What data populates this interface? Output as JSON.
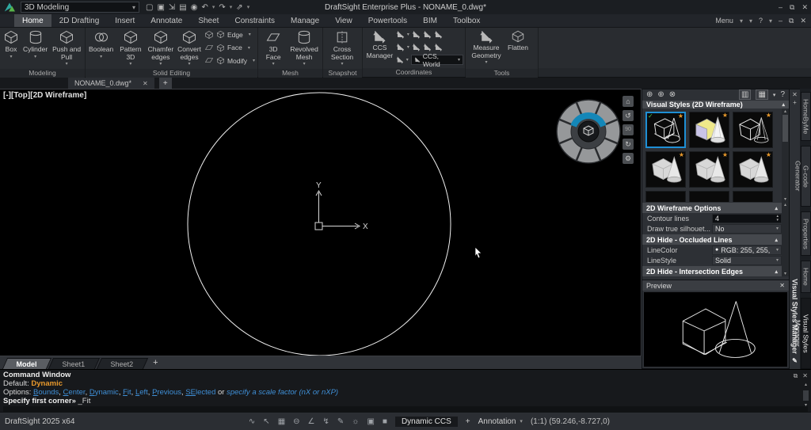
{
  "titlebar": {
    "workspace": "3D Modeling",
    "title": "DraftSight Enterprise Plus - NONAME_0.dwg*",
    "menu": "Menu",
    "help": "?"
  },
  "tabs": {
    "items": [
      "Home",
      "2D Drafting",
      "Insert",
      "Annotate",
      "Sheet",
      "Constraints",
      "Manage",
      "View",
      "Powertools",
      "BIM",
      "Toolbox"
    ],
    "active": "Home"
  },
  "ribbon": {
    "modeling": {
      "label": "Modeling",
      "box": "Box",
      "cylinder": "Cylinder",
      "push_pull": "Push and Pull"
    },
    "solid_editing": {
      "label": "Solid Editing",
      "boolean": "Boolean",
      "pattern": "Pattern 3D",
      "chamfer": "Chamfer edges",
      "convert": "Convert edges",
      "edge": "Edge",
      "face": "Face",
      "modify": "Modify"
    },
    "mesh": {
      "label": "Mesh",
      "face3d": "3D Face",
      "revolved": "Revolved Mesh"
    },
    "snapshot": {
      "label": "Snapshot",
      "cross_section": "Cross Section"
    },
    "coordinates": {
      "label": "Coordinates",
      "ccs_manager": "CCS Manager",
      "ccs_world": "CCS, World"
    },
    "tools": {
      "label": "Tools",
      "measure": "Measure Geometry",
      "flatten": "Flatten"
    }
  },
  "document_tab": {
    "name": "NONAME_0.dwg*"
  },
  "canvas": {
    "view_label": "[-][Top][2D Wireframe]",
    "axis_x": "X",
    "axis_y": "Y",
    "wheel_angle": "90"
  },
  "panel": {
    "title": "Visual Styles Manager",
    "styles_header": "Visual Styles (2D Wireframe)",
    "wireframe_options": {
      "title": "2D Wireframe Options",
      "contour_label": "Contour lines",
      "contour_value": "4",
      "silhouette_label": "Draw true silhouet...",
      "silhouette_value": "No"
    },
    "occluded": {
      "title": "2D Hide - Occluded Lines",
      "linecolor_label": "LineColor",
      "linecolor_value": "RGB: 255, 255,",
      "linestyle_label": "LineStyle",
      "linestyle_value": "Solid"
    },
    "intersection": {
      "title": "2D Hide - Intersection Edges"
    },
    "preview_title": "Preview"
  },
  "side_tabs": {
    "items": [
      "HomeByMe",
      "G-code Generator",
      "Properties",
      "Home",
      "Visual Styles Manager"
    ],
    "active": "Visual Styles Manager"
  },
  "sheet_tabs": {
    "items": [
      "Model",
      "Sheet1",
      "Sheet2"
    ],
    "active": "Model"
  },
  "command": {
    "header": "Command Window",
    "default_label": "Default:",
    "default_value": "Dynamic",
    "options_label": "Options:",
    "options": [
      {
        "u": "B",
        "rest": "ounds"
      },
      {
        "u": "C",
        "rest": "enter"
      },
      {
        "u": "D",
        "rest": "ynamic"
      },
      {
        "u": "F",
        "rest": "it"
      },
      {
        "u": "L",
        "rest": "eft"
      },
      {
        "u": "P",
        "rest": "revious"
      },
      {
        "u": "SE",
        "rest": "lected"
      }
    ],
    "or_text": "or",
    "scale_hint": "specify a scale factor (nX or nXP)",
    "prompt": "Specify first corner»",
    "prompt_value": "_Fit"
  },
  "statusbar": {
    "app": "DraftSight 2025 x64",
    "dynamic_ccs": "Dynamic CCS",
    "plus": "+",
    "annotation": "Annotation",
    "coords": "(1:1)  (59.246,-8.727,0)"
  },
  "icons": {
    "caret": "▾",
    "collapse": "▴",
    "close": "✕",
    "minimize": "–",
    "restore": "⧉",
    "new_file": "▢",
    "open": "▣",
    "save_as": "⇲",
    "save": "▤",
    "web": "◉",
    "undo": "↶",
    "redo": "↷",
    "publish": "⇗",
    "style_new": "⊕",
    "style_apply": "⊕",
    "style_delete": "⊗",
    "apply_doc": "▥",
    "options_panel": "▦",
    "help": "?",
    "pin": "+",
    "pencil": "✎",
    "home": "⌂",
    "rotate_ccw": "↺",
    "rotate_cw": "↻",
    "gear": "⚙",
    "check": "✓",
    "star": "★",
    "bullet": "●",
    "snap": "∿",
    "pointer": "↖",
    "grid": "▦",
    "ortho": "⊖",
    "polar": "∠",
    "esnap": "↯",
    "etrack": "✎",
    "annoscale": "☼",
    "lineweight": "▣",
    "printarea": "■"
  },
  "colors": {
    "accent_blue": "#1e8fd5",
    "wheel_blue": "#1487b8",
    "orange": "#e8992c",
    "link_blue": "#3f8fd6",
    "canvas_line": "#f0f0f0"
  }
}
